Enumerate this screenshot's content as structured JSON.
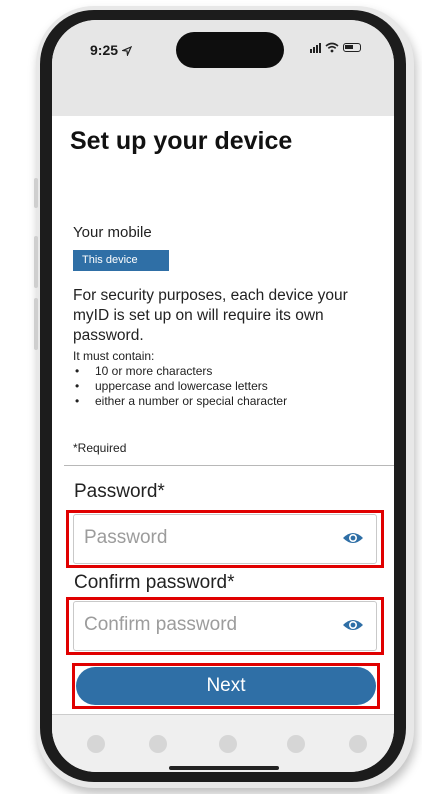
{
  "status_bar": {
    "time": "9:25"
  },
  "screen": {
    "title": "Set up your device",
    "device_section": {
      "label": "Your mobile",
      "badge": "This device"
    },
    "security_text": "For security purposes, each device your myID is set up on will require its own password.",
    "requirements_heading": "It must contain:",
    "requirements": [
      "10 or more characters",
      "uppercase and lowercase letters",
      "either a number or special character"
    ],
    "required_note": "*Required"
  },
  "form": {
    "password": {
      "label": "Password*",
      "placeholder": "Password",
      "value": ""
    },
    "confirm_password": {
      "label": "Confirm password*",
      "placeholder": "Confirm password",
      "value": ""
    },
    "next_label": "Next"
  },
  "icons": {
    "eye": "eye-icon"
  },
  "colors": {
    "accent": "#2f6fa6",
    "highlight": "#e00000",
    "eye": "#2f6fa6"
  }
}
